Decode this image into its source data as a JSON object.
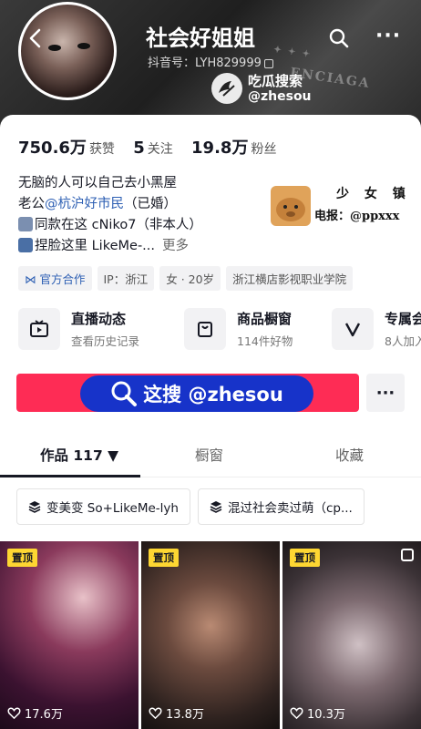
{
  "profile": {
    "nickname": "社会好姐姐",
    "douyin_id": "抖音号：LYH829999"
  },
  "watermark": {
    "title": "吃瓜搜索",
    "handle": "@zhesou",
    "side_line1": "少 女 镇",
    "side_line2": "电报：@ppxxx"
  },
  "stats": [
    {
      "value": "750.6万",
      "label": "获赞"
    },
    {
      "value": "5",
      "label": "关注"
    },
    {
      "value": "19.8万",
      "label": "粉丝"
    }
  ],
  "bio": {
    "line1": "无脑的人可以自己去小黑屋",
    "line2_prefix": "老公",
    "line2_mention": "@杭沪好市民",
    "line2_suffix": "（已婚）",
    "line3": "同款在这 cNiko7（非本人）",
    "line4": "捏脸这里 LikeMe-...",
    "more": "更多"
  },
  "tags": [
    "官方合作",
    "IP：浙江",
    "女 · 20岁",
    "浙江横店影视职业学院"
  ],
  "features": [
    {
      "title": "直播动态",
      "sub": "查看历史记录",
      "icon": "tv-icon"
    },
    {
      "title": "商品橱窗",
      "sub": "114件好物",
      "icon": "shop-bag-icon"
    },
    {
      "title": "专属会",
      "sub": "8人加入",
      "icon": "v-badge-icon"
    }
  ],
  "promo": {
    "text": "这搜 @zhesou"
  },
  "tabs": [
    {
      "label": "作品 117 ▼"
    },
    {
      "label": "橱窗"
    },
    {
      "label": "收藏"
    }
  ],
  "collections": [
    "变美变 So+LikeMe-lyh",
    "混过社会卖过萌（cp..."
  ],
  "videos": [
    {
      "pinned": "置顶",
      "likes": "17.6万"
    },
    {
      "pinned": "置顶",
      "likes": "13.8万"
    },
    {
      "pinned": "置顶",
      "likes": "10.3万"
    }
  ],
  "colors": {
    "primary_red": "#fe2c55",
    "promo_blue": "#1733c9",
    "pin_yellow": "#fdd632",
    "link_blue": "#2d5fb3"
  }
}
